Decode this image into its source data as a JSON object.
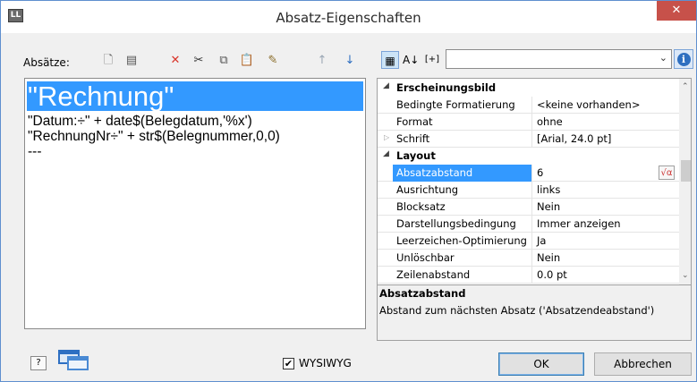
{
  "window": {
    "title": "Absatz-Eigenschaften",
    "app_icon_text": "LL",
    "close_glyph": "✕"
  },
  "left": {
    "label": "Absätze:",
    "toolbar": [
      {
        "name": "new-paragraph-icon",
        "glyph": "🗋",
        "color": "#666666"
      },
      {
        "name": "paragraph-properties-icon",
        "glyph": "▤",
        "color": "#555555"
      },
      {
        "name": "delete-icon",
        "glyph": "✕",
        "color": "#d9352b"
      },
      {
        "name": "cut-icon",
        "glyph": "✂",
        "color": "#333333"
      },
      {
        "name": "copy-icon",
        "glyph": "⧉",
        "color": "#555555"
      },
      {
        "name": "paste-icon",
        "glyph": "📋",
        "color": "#555555"
      },
      {
        "name": "format-brush-icon",
        "glyph": "✎",
        "color": "#8a6d2a"
      },
      {
        "name": "move-up-icon",
        "glyph": "↑",
        "color": "#9aa6b4"
      },
      {
        "name": "move-down-icon",
        "glyph": "↓",
        "color": "#2e6fc0"
      }
    ],
    "lines": [
      "\"Rechnung\"",
      "\"Datum:÷\" + date$(Belegdatum,'%x')",
      "\"RechnungNr÷\" + str$(Belegnummer,0,0)",
      "---"
    ]
  },
  "right": {
    "toolbar": [
      {
        "name": "categorized-view-icon",
        "glyph": "▦"
      },
      {
        "name": "sort-alphabetical-icon",
        "glyph": "A↓"
      },
      {
        "name": "expand-all-icon",
        "glyph": "[+]"
      }
    ],
    "combo_value": "",
    "info_glyph": "i",
    "properties": [
      {
        "type": "category",
        "name": "Erscheinungsbild"
      },
      {
        "type": "prop",
        "name": "Bedingte Formatierung",
        "value": "<keine vorhanden>"
      },
      {
        "type": "prop",
        "name": "Format",
        "value": "ohne"
      },
      {
        "type": "prop",
        "name": "Schrift",
        "value": "[Arial, 24.0 pt]",
        "expandable": true
      },
      {
        "type": "category",
        "name": "Layout"
      },
      {
        "type": "prop",
        "name": "Absatzabstand",
        "value": "6",
        "selected": true
      },
      {
        "type": "prop",
        "name": "Ausrichtung",
        "value": "links"
      },
      {
        "type": "prop",
        "name": "Blocksatz",
        "value": "Nein"
      },
      {
        "type": "prop",
        "name": "Darstellungsbedingung",
        "value": "Immer anzeigen"
      },
      {
        "type": "prop",
        "name": "Leerzeichen-Optimierung",
        "value": "Ja"
      },
      {
        "type": "prop",
        "name": "Unlöschbar",
        "value": "Nein"
      },
      {
        "type": "prop",
        "name": "Zeilenabstand",
        "value": "0.0 pt"
      }
    ],
    "formula_glyph": "√α",
    "description": {
      "title": "Absatzabstand",
      "text": "Abstand zum nächsten Absatz ('Absatzendeabstand')"
    }
  },
  "footer": {
    "help_glyph": "?",
    "wysiwyg_label": "WYSIWYG",
    "wysiwyg_checked": true,
    "ok_label": "OK",
    "cancel_label": "Abbrechen"
  }
}
